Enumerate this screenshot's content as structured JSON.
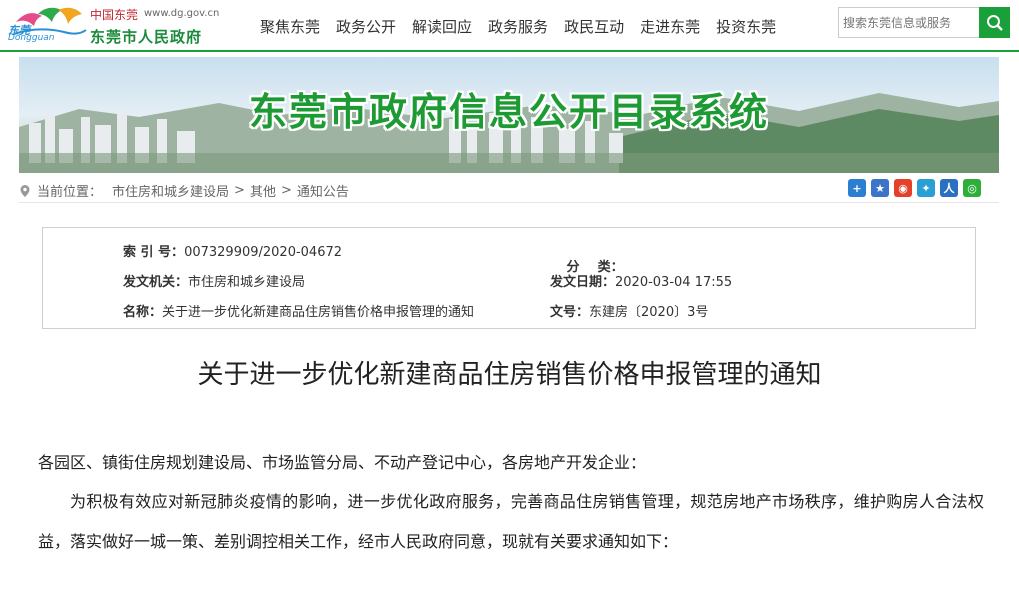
{
  "header": {
    "logo_brand": "东莞",
    "logo_brand_en": "Dongguan",
    "logo_cn": "中国东莞",
    "logo_url": "www.dg.gov.cn",
    "logo_title": "东莞市人民政府",
    "nav": [
      "聚焦东莞",
      "政务公开",
      "解读回应",
      "政务服务",
      "政民互动",
      "走进东莞",
      "投资东莞"
    ],
    "search_placeholder": "搜索东莞信息或服务"
  },
  "banner": {
    "title": "东莞市政府信息公开目录系统"
  },
  "breadcrumb": {
    "prefix": "当前位置：",
    "items": [
      "市住房和城乡建设局",
      "其他",
      "通知公告"
    ]
  },
  "share_icons": [
    "plus-icon",
    "favorite-icon",
    "weibo-icon",
    "qzone-icon",
    "renren-icon",
    "wechat-icon"
  ],
  "meta": {
    "index_label": "索 引 号：",
    "index_value": "007329909/2020-04672",
    "category_label": "分    类：",
    "category_value": "",
    "issuer_label": "发文机关：",
    "issuer_value": "市住房和城乡建设局",
    "date_label": "发文日期：",
    "date_value": "2020-03-04 17:55",
    "name_label": "名称：",
    "name_value": "关于进一步优化新建商品住房销售价格申报管理的通知",
    "docno_label": "文号：",
    "docno_value": "东建房〔2020〕3号"
  },
  "article": {
    "title": "关于进一步优化新建商品住房销售价格申报管理的通知",
    "addressee": "各园区、镇街住房规划建设局、市场监管分局、不动产登记中心，各房地产开发企业：",
    "para1": "为积极有效应对新冠肺炎疫情的影响，进一步优化政府服务，完善商品住房销售管理，规范房地产市场秩序，维护购房人合法权益，落实做好一城一策、差别调控相关工作，经市人民政府同意，现就有关要求通知如下："
  },
  "colors": {
    "brand_green": "#1aa03b",
    "banner_title": "#1d9a33"
  }
}
